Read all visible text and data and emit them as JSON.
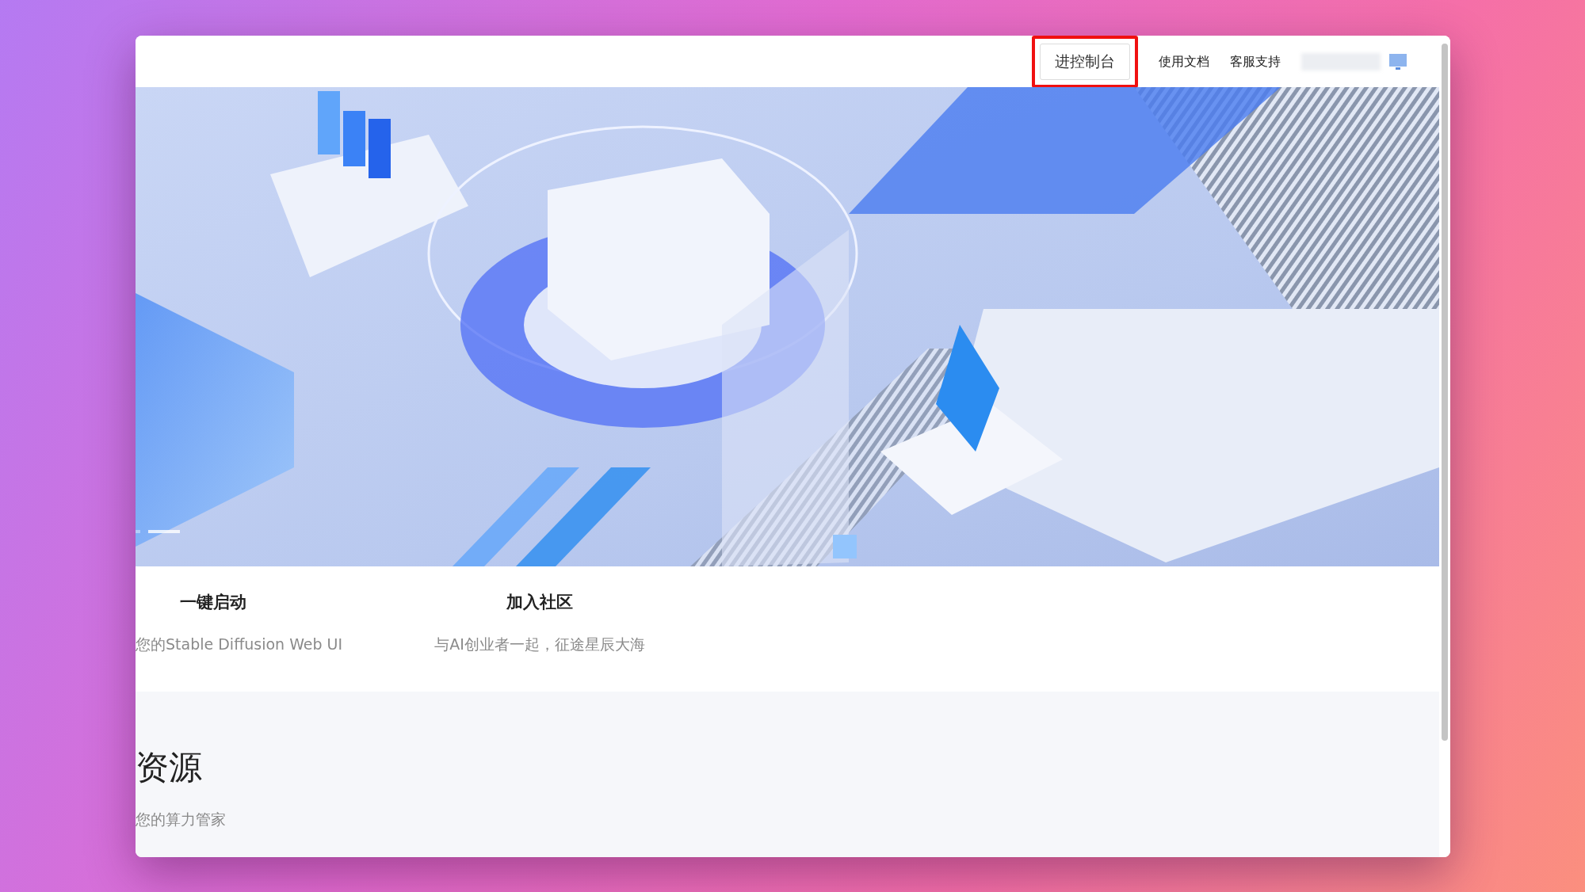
{
  "nav": {
    "console_button": {
      "label": "进控制台",
      "highlighted": true
    },
    "links": [
      {
        "label": "使用文档"
      },
      {
        "label": "客服支持"
      }
    ]
  },
  "banner": {
    "carousel": [
      {
        "selected": false
      },
      {
        "selected": true
      }
    ]
  },
  "features": [
    {
      "title": "一键启动",
      "description": "您的Stable Diffusion Web UI"
    },
    {
      "title": "加入社区",
      "description": "与AI创业者一起，征途星辰大海"
    }
  ],
  "resources": {
    "title": "资源",
    "subtitle": "您的算力管家"
  }
}
